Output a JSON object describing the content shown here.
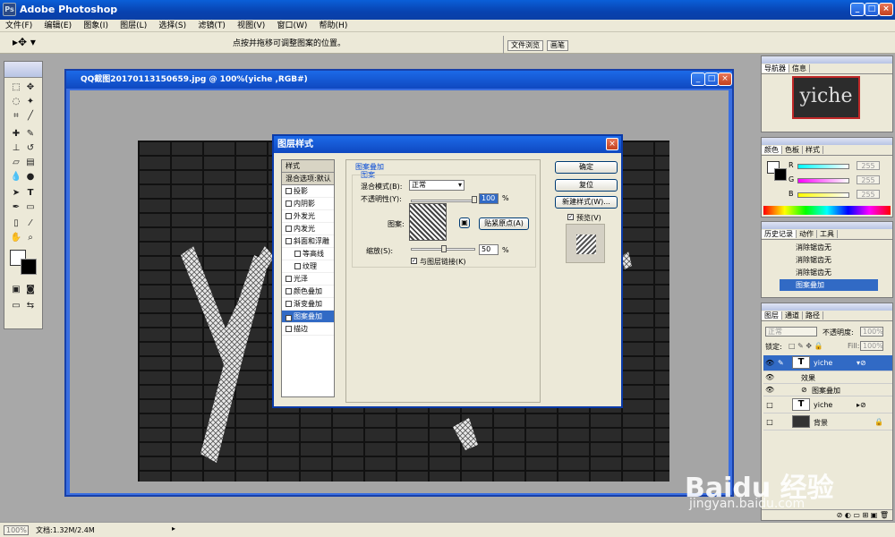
{
  "app": {
    "title": "Adobe Photoshop"
  },
  "menu": [
    "文件(F)",
    "编辑(E)",
    "图象(I)",
    "图层(L)",
    "选择(S)",
    "滤镜(T)",
    "视图(V)",
    "窗口(W)",
    "帮助(H)"
  ],
  "options_bar": {
    "hint": "点按并拖移可调整图案的位置。",
    "wells": [
      "文件浏览",
      "画笔"
    ]
  },
  "document": {
    "title": "QQ截图20170113150659.jpg @ 100%(yiche ,RGB#)"
  },
  "dialog": {
    "title": "图层样式",
    "styles": [
      {
        "label": "样式",
        "header": true
      },
      {
        "label": "混合选项:默认",
        "header": true
      },
      {
        "label": "投影",
        "checked": false
      },
      {
        "label": "内阴影",
        "checked": false
      },
      {
        "label": "外发光",
        "checked": false
      },
      {
        "label": "内发光",
        "checked": false
      },
      {
        "label": "斜面和浮雕",
        "checked": false
      },
      {
        "label": "等高线",
        "checked": false,
        "indent": true
      },
      {
        "label": "纹理",
        "checked": false,
        "indent": true
      },
      {
        "label": "光泽",
        "checked": false
      },
      {
        "label": "颜色叠加",
        "checked": false
      },
      {
        "label": "渐变叠加",
        "checked": false
      },
      {
        "label": "图案叠加",
        "checked": true,
        "selected": true
      },
      {
        "label": "描边",
        "checked": false
      }
    ],
    "section_title": "图案叠加",
    "group_title": "图案",
    "blend_mode_label": "混合模式(B):",
    "blend_mode_value": "正常",
    "opacity_label": "不透明性(Y):",
    "opacity_value": "100",
    "percent": "%",
    "pattern_label": "图案:",
    "snap_button": "贴紧原点(A)",
    "scale_label": "缩放(S):",
    "scale_value": "50",
    "link_label": "与图层链接(K)",
    "ok": "确定",
    "reset": "复位",
    "new_style": "新建样式(W)...",
    "preview_label": "预览(V)"
  },
  "panels": {
    "navigator": {
      "tabs": [
        "导航器",
        "信息"
      ],
      "thumb_text": "yiche"
    },
    "color": {
      "tabs": [
        "颜色",
        "色板",
        "样式"
      ],
      "channels": [
        {
          "name": "R",
          "value": "255"
        },
        {
          "name": "G",
          "value": "255"
        },
        {
          "name": "B",
          "value": "255"
        }
      ]
    },
    "history": {
      "tabs": [
        "历史记录",
        "动作",
        "工具"
      ],
      "items": [
        "消除锯齿无",
        "消除锯齿无",
        "消除锯齿无",
        "图案叠加"
      ]
    },
    "layers": {
      "tabs": [
        "图层",
        "通道",
        "路径"
      ],
      "blend": "正常",
      "opacity_label": "不透明度:",
      "opacity_value": "100%",
      "lock_label": "锁定:",
      "fill_label": "Fill:",
      "fill_value": "100%",
      "rows": [
        {
          "name": "yiche",
          "thumb": "T",
          "selected": true
        },
        {
          "name": "效果",
          "sub": true
        },
        {
          "name": "图案叠加",
          "sub": true
        },
        {
          "name": "yiche",
          "thumb": "T"
        },
        {
          "name": "背景",
          "thumb": "bg"
        }
      ]
    }
  },
  "status": {
    "zoom": "100%",
    "doc_size": "文档:1.32M/2.4M"
  },
  "watermark": {
    "brand": "Baidu 经验",
    "url": "jingyan.baidu.com"
  }
}
